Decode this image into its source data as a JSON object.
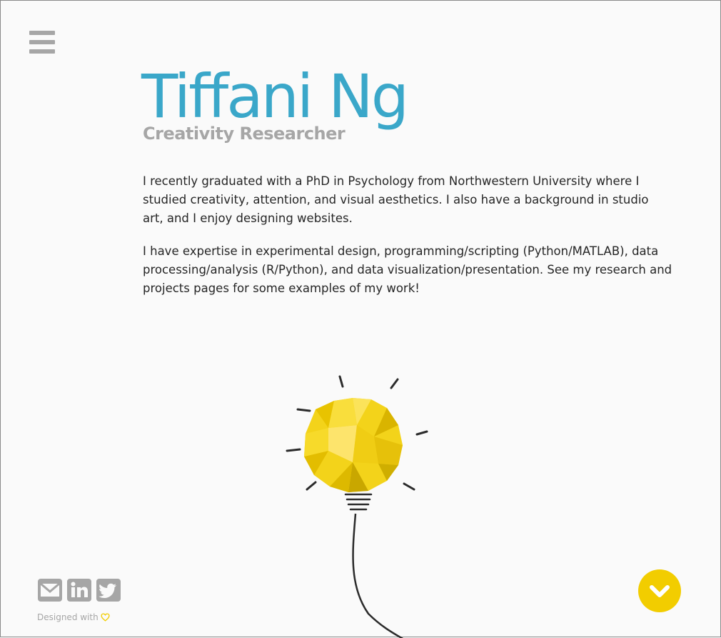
{
  "header": {
    "menu_icon": "hamburger-menu-icon",
    "name": "Tiffani Ng",
    "subtitle": "Creativity Researcher"
  },
  "bio": {
    "paragraph1": "I recently graduated with a PhD in Psychology from Northwestern University where I studied creativity, attention, and visual aesthetics. I also have a background in studio art, and I enjoy designing websites.",
    "paragraph2": "I have expertise in experimental design, programming/scripting (Python/MATLAB), data processing/analysis (R/Python), and data visualization/presentation. See my research and projects pages for some examples of my work!"
  },
  "footer": {
    "social_icons": [
      "email-icon",
      "linkedin-icon",
      "twitter-icon"
    ],
    "designed_with": "Designed with",
    "heart_icon": "heart-icon",
    "scroll_icon": "chevron-down-icon"
  },
  "colors": {
    "name": "#3aa7c9",
    "subtitle": "#a6a6a6",
    "text": "#262626",
    "accent": "#f2cd00",
    "icons": "#a6a6a6",
    "background": "#fafafa"
  }
}
